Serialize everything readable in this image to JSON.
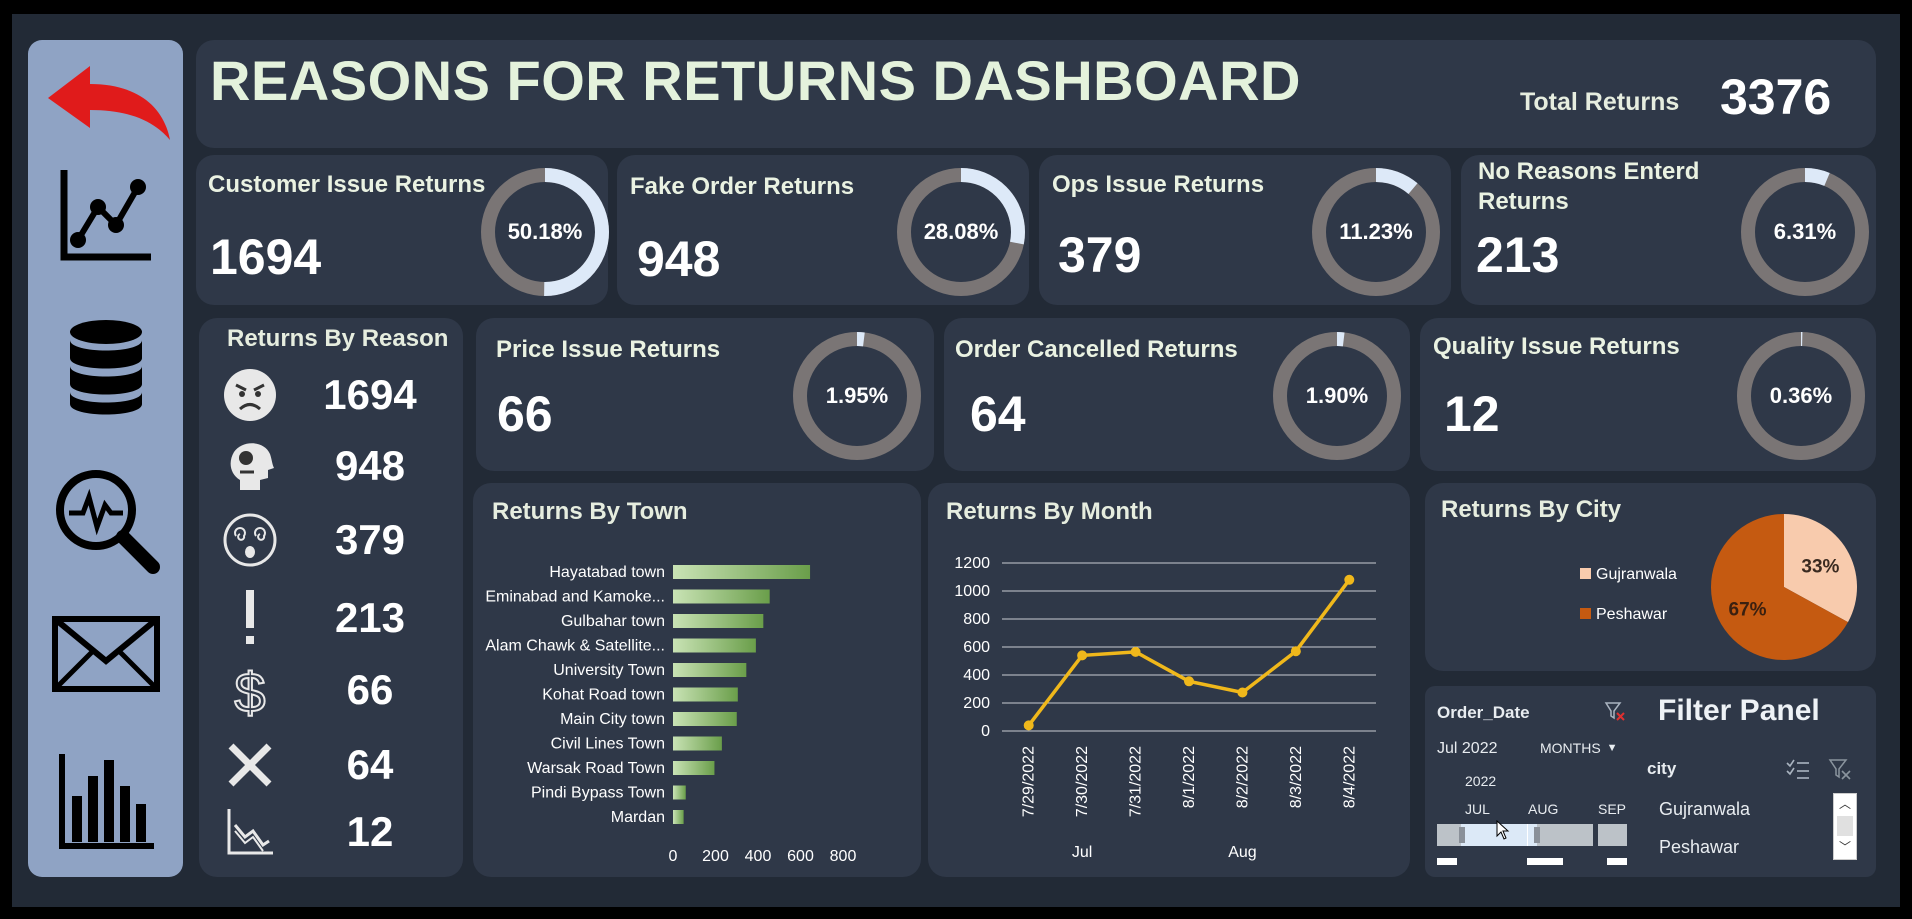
{
  "header": {
    "title": "REASONS FOR RETURNS DASHBOARD",
    "total_label": "Total Returns",
    "total_value": "3376"
  },
  "sidebar": {
    "icons": [
      "back-arrow-icon",
      "line-chart-icon",
      "database-icon",
      "analytics-search-icon",
      "mail-icon",
      "bar-chart-icon"
    ]
  },
  "kpis": [
    {
      "label": "Customer Issue Returns",
      "value": "1694",
      "pct_text": "50.18%",
      "pct": 0.5018
    },
    {
      "label": "Fake Order Returns",
      "value": "948",
      "pct_text": "28.08%",
      "pct": 0.2808
    },
    {
      "label": "Ops Issue Returns",
      "value": "379",
      "pct_text": "11.23%",
      "pct": 0.1123
    },
    {
      "label": "No Reasons Enterd Returns",
      "value": "213",
      "pct_text": "6.31%",
      "pct": 0.0631
    },
    {
      "label": "Price Issue Returns",
      "value": "66",
      "pct_text": "1.95%",
      "pct": 0.0195
    },
    {
      "label": "Order Cancelled Returns",
      "value": "64",
      "pct_text": "1.90%",
      "pct": 0.019
    },
    {
      "label": "Quality Issue Returns",
      "value": "12",
      "pct_text": "0.36%",
      "pct": 0.0036
    }
  ],
  "returns_by_reason": {
    "title": "Returns By Reason",
    "rows": [
      {
        "icon": "angry-face-icon",
        "value": "1694"
      },
      {
        "icon": "head-profile-icon",
        "value": "948"
      },
      {
        "icon": "dizzy-face-icon",
        "value": "379"
      },
      {
        "icon": "exclamation-icon",
        "value": "213"
      },
      {
        "icon": "dollar-icon",
        "value": "66"
      },
      {
        "icon": "cross-icon",
        "value": "64"
      },
      {
        "icon": "declining-chart-icon",
        "value": "12"
      }
    ]
  },
  "colors": {
    "donut_fill": "#dde9f8",
    "donut_track": "#7a7575",
    "bar_green": "#6a9e4a",
    "line_gold": "#f0b81b",
    "peshawar": "#c55a11",
    "gujranwala": "#f8cbad"
  },
  "chart_data": [
    {
      "type": "bar",
      "title": "Returns By Town",
      "categories": [
        "Hayatabad town",
        "Eminabad and Kamoke...",
        "Gulbahar town",
        "Alam Chawk & Satellite...",
        "University Town",
        "Kohat Road town",
        "Main City town",
        "Civil Lines Town",
        "Warsak Road Town",
        "Pindi Bypass Town",
        "Mardan"
      ],
      "values": [
        645,
        455,
        425,
        390,
        345,
        305,
        300,
        230,
        195,
        60,
        50
      ],
      "xlim": [
        0,
        800
      ],
      "xticks": [
        "0",
        "200",
        "400",
        "600",
        "800"
      ]
    },
    {
      "type": "line",
      "title": "Returns By Month",
      "x": [
        "7/29/2022",
        "7/30/2022",
        "7/31/2022",
        "8/1/2022",
        "8/2/2022",
        "8/3/2022",
        "8/4/2022"
      ],
      "values": [
        40,
        540,
        565,
        355,
        275,
        570,
        1080
      ],
      "groups": [
        "Jul",
        "Aug"
      ],
      "ylim": [
        0,
        1200
      ],
      "yticks": [
        "0",
        "200",
        "400",
        "600",
        "800",
        "1000",
        "1200"
      ],
      "grid": true
    },
    {
      "type": "pie",
      "title": "Returns By City",
      "categories": [
        "Gujranwala",
        "Peshawar"
      ],
      "values": [
        33,
        67
      ],
      "labels": [
        "33%",
        "67%"
      ],
      "legend": "left"
    }
  ],
  "filter_panel": {
    "title": "Filter Panel",
    "order_date": {
      "label": "Order_Date",
      "selected": "Jul 2022",
      "level": "MONTHS",
      "year": "2022",
      "months": [
        "JUL",
        "AUG",
        "SEP"
      ]
    },
    "city": {
      "label": "city",
      "items": [
        "Gujranwala",
        "Peshawar"
      ]
    }
  }
}
